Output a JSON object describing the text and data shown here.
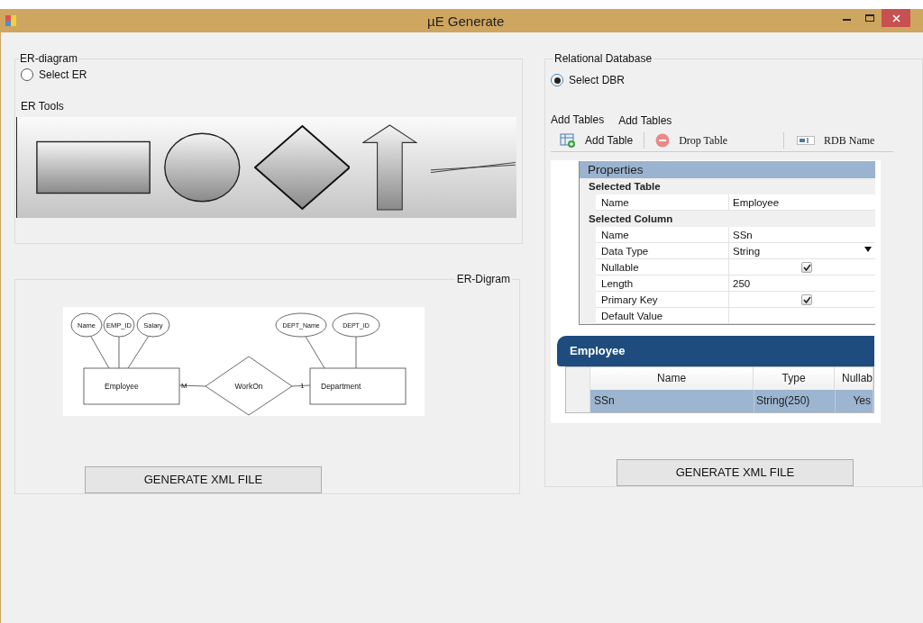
{
  "window": {
    "title": "µE Generate"
  },
  "er_panel": {
    "title": "ER-diagram",
    "radio": {
      "label": "Select ER",
      "selected": false
    },
    "tools_label": "ER Tools",
    "tools": [
      {
        "kind": "rectangle"
      },
      {
        "kind": "ellipse"
      },
      {
        "kind": "diamond"
      },
      {
        "kind": "arrow"
      },
      {
        "kind": "line"
      }
    ]
  },
  "diagram_panel": {
    "title": "ER-Digram",
    "entities": [
      {
        "name": "Employee",
        "attributes": [
          "Name",
          "EMP_ID",
          "Salary"
        ]
      },
      {
        "name": "Department",
        "attributes": [
          "DEPT_Name",
          "DEPT_ID"
        ]
      }
    ],
    "relationship": {
      "name": "WorkOn",
      "left_cardinality": "M",
      "right_cardinality": "1"
    },
    "button": "GENERATE XML FILE"
  },
  "db_panel": {
    "title": "Relational Database",
    "radio": {
      "label": "Select DBR",
      "selected": true
    },
    "tabs": [
      "Add Tables",
      "Add Tables"
    ],
    "toolbar": [
      {
        "kind": "add",
        "label": "Add Table"
      },
      {
        "kind": "drop",
        "label": "Drop Table"
      },
      {
        "kind": "name",
        "label": "RDB Name"
      }
    ],
    "properties": {
      "title": "Properties",
      "sections": [
        {
          "title": "Selected Table",
          "rows": [
            {
              "kind": "text",
              "label": "Name",
              "value": "Employee"
            }
          ]
        },
        {
          "title": "Selected Column",
          "rows": [
            {
              "kind": "text",
              "label": "Name",
              "value": "SSn"
            },
            {
              "kind": "dropdown",
              "label": "Data Type",
              "value": "String"
            },
            {
              "kind": "checkbox",
              "label": "Nullable",
              "checked": true
            },
            {
              "kind": "text",
              "label": "Length",
              "value": "250"
            },
            {
              "kind": "checkbox",
              "label": "Primary Key",
              "checked": true
            },
            {
              "kind": "text",
              "label": "Default Value"
            }
          ]
        }
      ]
    },
    "table": {
      "title": "Employee",
      "columns": [
        "Name",
        "Type",
        "Nullab"
      ],
      "rows": [
        {
          "selected": true,
          "cells": [
            "SSn",
            "String(250)",
            "Yes"
          ]
        }
      ]
    },
    "button": "GENERATE XML FILE"
  }
}
